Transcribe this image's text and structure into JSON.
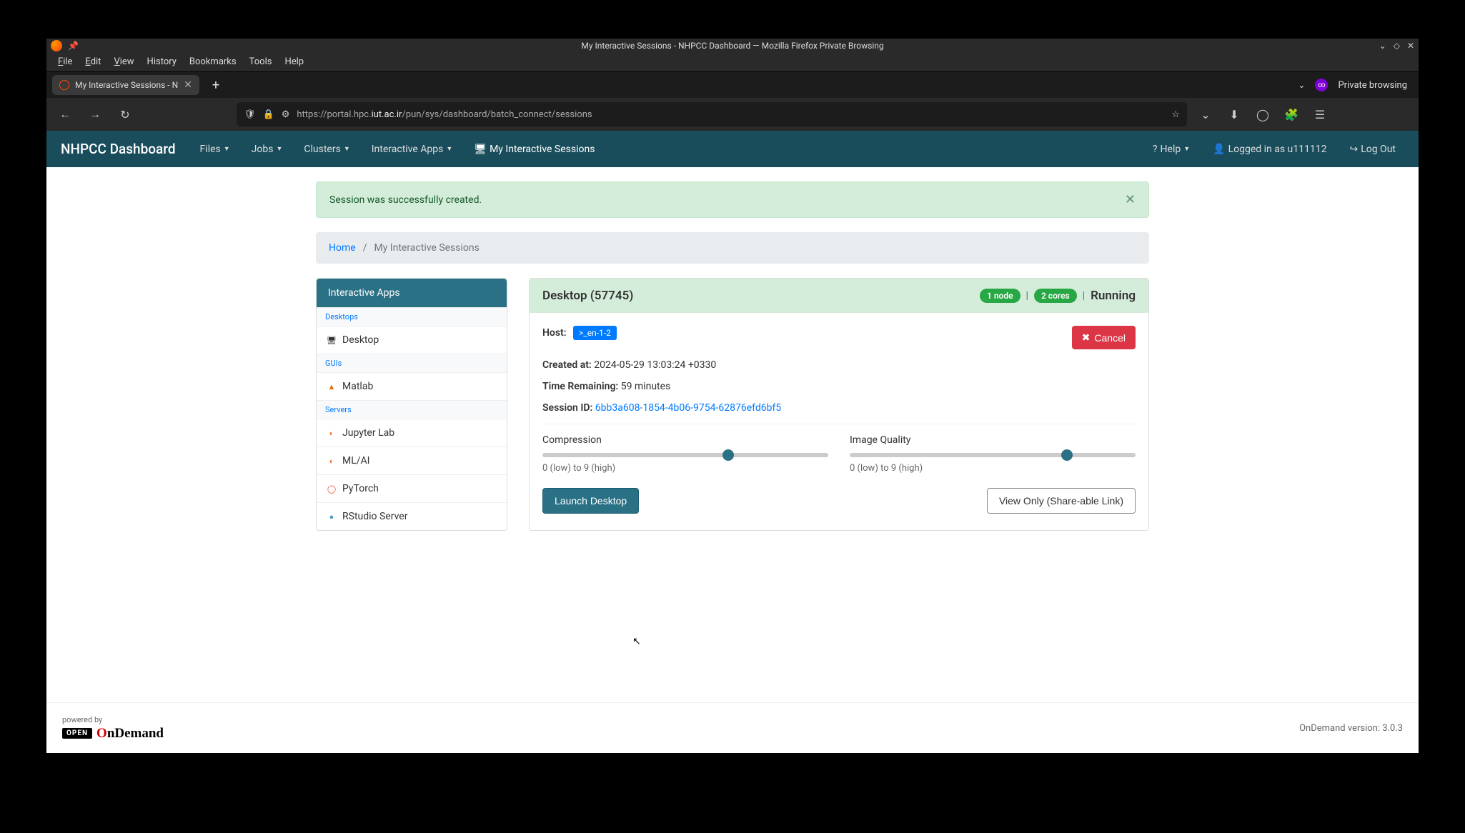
{
  "window": {
    "title": "My Interactive Sessions - NHPCC Dashboard — Mozilla Firefox Private Browsing"
  },
  "menubar": {
    "file": "File",
    "edit": "Edit",
    "view": "View",
    "history": "History",
    "bookmarks": "Bookmarks",
    "tools": "Tools",
    "help": "Help"
  },
  "tab": {
    "title": "My Interactive Sessions - N"
  },
  "private_label": "Private browsing",
  "url": {
    "prefix": "https://portal.hpc.",
    "domain": "iut.ac.ir",
    "path": "/pun/sys/dashboard/batch_connect/sessions"
  },
  "navbar": {
    "brand": "NHPCC Dashboard",
    "files": "Files",
    "jobs": "Jobs",
    "clusters": "Clusters",
    "interactive_apps": "Interactive Apps",
    "my_sessions": "My Interactive Sessions",
    "help": "Help",
    "logged_in": "Logged in as u111112",
    "logout": "Log Out"
  },
  "alert": {
    "text": "Session was successfully created."
  },
  "breadcrumb": {
    "home": "Home",
    "current": "My Interactive Sessions"
  },
  "sidebar": {
    "header": "Interactive Apps",
    "cat_desktops": "Desktops",
    "desktop": "Desktop",
    "cat_guis": "GUIs",
    "matlab": "Matlab",
    "cat_servers": "Servers",
    "jupyter": "Jupyter Lab",
    "mlai": "ML/AI",
    "pytorch": "PyTorch",
    "rstudio": "RStudio Server"
  },
  "session": {
    "title": "Desktop (57745)",
    "nodes_badge": "1 node",
    "cores_badge": "2 cores",
    "status": "Running",
    "host_label": "Host:",
    "host_value": ">_en-1-2",
    "cancel": "Cancel",
    "created_label": "Created at:",
    "created_value": "2024-05-29 13:03:24 +0330",
    "time_label": "Time Remaining:",
    "time_value": "59 minutes",
    "sessid_label": "Session ID:",
    "sessid_value": "6bb3a608-1854-4b06-9754-62876efd6bf5",
    "compression_label": "Compression",
    "quality_label": "Image Quality",
    "slider_hint": "0 (low) to 9 (high)",
    "launch": "Launch Desktop",
    "view_only": "View Only (Share-able Link)"
  },
  "footer": {
    "powered": "powered by",
    "open": "OPEN",
    "ondemand": "nDemand",
    "version": "OnDemand version: 3.0.3"
  }
}
